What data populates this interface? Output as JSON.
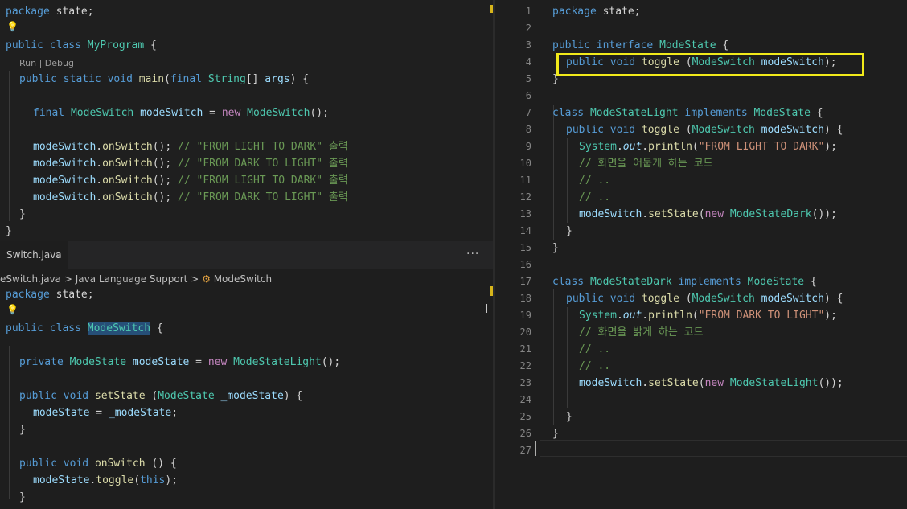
{
  "top_left": {
    "codelens": "Run | Debug",
    "lines": [
      [
        [
          "package",
          "kw"
        ],
        [
          " state;",
          "pl"
        ]
      ],
      [
        [
          "public",
          "kw"
        ],
        [
          " ",
          "pl"
        ],
        [
          "class",
          "kw"
        ],
        [
          " ",
          "pl"
        ],
        [
          "MyProgram",
          "type"
        ],
        [
          " {",
          "pl"
        ]
      ],
      [
        [
          "public",
          "kw"
        ],
        [
          " ",
          "pl"
        ],
        [
          "static",
          "kw"
        ],
        [
          " ",
          "pl"
        ],
        [
          "void",
          "kw"
        ],
        [
          " ",
          "pl"
        ],
        [
          "main",
          "fn"
        ],
        [
          "(",
          "pl"
        ],
        [
          "final",
          "kw"
        ],
        [
          " ",
          "pl"
        ],
        [
          "String",
          "type"
        ],
        [
          "[] ",
          "pl"
        ],
        [
          "args",
          "var"
        ],
        [
          ") {",
          "pl"
        ]
      ],
      [
        [
          "final",
          "kw"
        ],
        [
          " ",
          "pl"
        ],
        [
          "ModeSwitch",
          "type"
        ],
        [
          " ",
          "pl"
        ],
        [
          "modeSwitch",
          "var"
        ],
        [
          " = ",
          "pl"
        ],
        [
          "new",
          "ctl"
        ],
        [
          " ",
          "pl"
        ],
        [
          "ModeSwitch",
          "type"
        ],
        [
          "();",
          "pl"
        ]
      ],
      [
        [
          "modeSwitch",
          "var"
        ],
        [
          ".",
          "pl"
        ],
        [
          "onSwitch",
          "fn"
        ],
        [
          "(); ",
          "pl"
        ],
        [
          "// \"FROM LIGHT TO DARK\" 출력",
          "com"
        ]
      ],
      [
        [
          "modeSwitch",
          "var"
        ],
        [
          ".",
          "pl"
        ],
        [
          "onSwitch",
          "fn"
        ],
        [
          "(); ",
          "pl"
        ],
        [
          "// \"FROM DARK TO LIGHT\" 출력",
          "com"
        ]
      ],
      [
        [
          "modeSwitch",
          "var"
        ],
        [
          ".",
          "pl"
        ],
        [
          "onSwitch",
          "fn"
        ],
        [
          "(); ",
          "pl"
        ],
        [
          "// \"FROM LIGHT TO DARK\" 출력",
          "com"
        ]
      ],
      [
        [
          "modeSwitch",
          "var"
        ],
        [
          ".",
          "pl"
        ],
        [
          "onSwitch",
          "fn"
        ],
        [
          "(); ",
          "pl"
        ],
        [
          "// \"FROM DARK TO LIGHT\" 출력",
          "com"
        ]
      ],
      [
        [
          "}",
          "pl"
        ]
      ],
      [
        [
          "}",
          "pl"
        ]
      ]
    ]
  },
  "bottom_left": {
    "tab_label": "Switch.java",
    "tab_close": "×",
    "more_actions": "···",
    "breadcrumb": {
      "file": "eSwitch.java",
      "sep1": ">",
      "section": "Java Language Support",
      "sep2": ">",
      "icon": "symbol-class-icon",
      "symbol": "ModeSwitch"
    },
    "lines": [
      [
        [
          "package",
          "kw"
        ],
        [
          " state;",
          "pl"
        ]
      ],
      [
        [
          "public",
          "kw"
        ],
        [
          " ",
          "pl"
        ],
        [
          "class",
          "kw"
        ],
        [
          " ",
          "pl"
        ],
        [
          "ModeSwitch",
          "type-sel"
        ],
        [
          " {",
          "pl"
        ]
      ],
      [
        [
          "private",
          "kw"
        ],
        [
          " ",
          "pl"
        ],
        [
          "ModeState",
          "type"
        ],
        [
          " ",
          "pl"
        ],
        [
          "modeState",
          "var"
        ],
        [
          " = ",
          "pl"
        ],
        [
          "new",
          "ctl"
        ],
        [
          " ",
          "pl"
        ],
        [
          "ModeStateLight",
          "type"
        ],
        [
          "();",
          "pl"
        ]
      ],
      [
        [
          "public",
          "kw"
        ],
        [
          " ",
          "pl"
        ],
        [
          "void",
          "kw"
        ],
        [
          " ",
          "pl"
        ],
        [
          "setState",
          "fn"
        ],
        [
          " (",
          "pl"
        ],
        [
          "ModeState",
          "type"
        ],
        [
          " ",
          "pl"
        ],
        [
          "_modeState",
          "var"
        ],
        [
          ") {",
          "pl"
        ]
      ],
      [
        [
          "modeState",
          "var"
        ],
        [
          " = ",
          "pl"
        ],
        [
          "_modeState",
          "var"
        ],
        [
          ";",
          "pl"
        ]
      ],
      [
        [
          "}",
          "pl"
        ]
      ],
      [
        [
          "public",
          "kw"
        ],
        [
          " ",
          "pl"
        ],
        [
          "void",
          "kw"
        ],
        [
          " ",
          "pl"
        ],
        [
          "onSwitch",
          "fn"
        ],
        [
          " () {",
          "pl"
        ]
      ],
      [
        [
          "modeState",
          "var"
        ],
        [
          ".",
          "pl"
        ],
        [
          "toggle",
          "fn"
        ],
        [
          "(",
          "pl"
        ],
        [
          "this",
          "kw"
        ],
        [
          ");",
          "pl"
        ]
      ],
      [
        [
          "}",
          "pl"
        ]
      ]
    ]
  },
  "right": {
    "line_numbers": [
      "1",
      "2",
      "3",
      "4",
      "5",
      "6",
      "7",
      "8",
      "9",
      "10",
      "11",
      "12",
      "13",
      "14",
      "15",
      "16",
      "17",
      "18",
      "19",
      "20",
      "21",
      "22",
      "23",
      "24",
      "25",
      "26",
      "27"
    ],
    "lines": [
      [
        [
          "package",
          "kw"
        ],
        [
          " state;",
          "pl"
        ]
      ],
      [],
      [
        [
          "public",
          "kw"
        ],
        [
          " ",
          "pl"
        ],
        [
          "interface",
          "kw"
        ],
        [
          " ",
          "pl"
        ],
        [
          "ModeState",
          "type"
        ],
        [
          " {",
          "pl"
        ]
      ],
      [
        [
          "public",
          "kw"
        ],
        [
          " ",
          "pl"
        ],
        [
          "void",
          "kw"
        ],
        [
          " ",
          "pl"
        ],
        [
          "toggle",
          "fn"
        ],
        [
          " (",
          "pl"
        ],
        [
          "ModeSwitch",
          "type"
        ],
        [
          " ",
          "pl"
        ],
        [
          "modeSwitch",
          "var"
        ],
        [
          ");",
          "pl"
        ]
      ],
      [
        [
          "}",
          "pl"
        ]
      ],
      [],
      [
        [
          "class",
          "kw"
        ],
        [
          " ",
          "pl"
        ],
        [
          "ModeStateLight",
          "type"
        ],
        [
          " ",
          "pl"
        ],
        [
          "implements",
          "kw"
        ],
        [
          " ",
          "pl"
        ],
        [
          "ModeState",
          "type"
        ],
        [
          " {",
          "pl"
        ]
      ],
      [
        [
          "public",
          "kw"
        ],
        [
          " ",
          "pl"
        ],
        [
          "void",
          "kw"
        ],
        [
          " ",
          "pl"
        ],
        [
          "toggle",
          "fn"
        ],
        [
          " (",
          "pl"
        ],
        [
          "ModeSwitch",
          "type"
        ],
        [
          " ",
          "pl"
        ],
        [
          "modeSwitch",
          "var"
        ],
        [
          ") {",
          "pl"
        ]
      ],
      [
        [
          "System",
          "type"
        ],
        [
          ".",
          "pl"
        ],
        [
          "out",
          "it"
        ],
        [
          ".",
          "pl"
        ],
        [
          "println",
          "fn"
        ],
        [
          "(",
          "pl"
        ],
        [
          "\"FROM LIGHT TO DARK\"",
          "str"
        ],
        [
          ");",
          "pl"
        ]
      ],
      [
        [
          "// 화면을 어둡게 하는 코드",
          "com"
        ]
      ],
      [
        [
          "// ..",
          "com"
        ]
      ],
      [
        [
          "// ..",
          "com"
        ]
      ],
      [
        [
          "modeSwitch",
          "var"
        ],
        [
          ".",
          "pl"
        ],
        [
          "setState",
          "fn"
        ],
        [
          "(",
          "pl"
        ],
        [
          "new",
          "ctl"
        ],
        [
          " ",
          "pl"
        ],
        [
          "ModeStateDark",
          "type"
        ],
        [
          "());",
          "pl"
        ]
      ],
      [
        [
          "}",
          "pl"
        ]
      ],
      [
        [
          "}",
          "pl"
        ]
      ],
      [],
      [
        [
          "class",
          "kw"
        ],
        [
          " ",
          "pl"
        ],
        [
          "ModeStateDark",
          "type"
        ],
        [
          " ",
          "pl"
        ],
        [
          "implements",
          "kw"
        ],
        [
          " ",
          "pl"
        ],
        [
          "ModeState",
          "type"
        ],
        [
          " {",
          "pl"
        ]
      ],
      [
        [
          "public",
          "kw"
        ],
        [
          " ",
          "pl"
        ],
        [
          "void",
          "kw"
        ],
        [
          " ",
          "pl"
        ],
        [
          "toggle",
          "fn"
        ],
        [
          " (",
          "pl"
        ],
        [
          "ModeSwitch",
          "type"
        ],
        [
          " ",
          "pl"
        ],
        [
          "modeSwitch",
          "var"
        ],
        [
          ") {",
          "pl"
        ]
      ],
      [
        [
          "System",
          "type"
        ],
        [
          ".",
          "pl"
        ],
        [
          "out",
          "it"
        ],
        [
          ".",
          "pl"
        ],
        [
          "println",
          "fn"
        ],
        [
          "(",
          "pl"
        ],
        [
          "\"FROM DARK TO LIGHT\"",
          "str"
        ],
        [
          ");",
          "pl"
        ]
      ],
      [
        [
          "// 화면을 밝게 하는 코드",
          "com"
        ]
      ],
      [
        [
          "// ..",
          "com"
        ]
      ],
      [
        [
          "// ..",
          "com"
        ]
      ],
      [
        [
          "modeSwitch",
          "var"
        ],
        [
          ".",
          "pl"
        ],
        [
          "setState",
          "fn"
        ],
        [
          "(",
          "pl"
        ],
        [
          "new",
          "ctl"
        ],
        [
          " ",
          "pl"
        ],
        [
          "ModeStateLight",
          "type"
        ],
        [
          "());",
          "pl"
        ]
      ],
      [],
      [
        [
          "}",
          "pl"
        ]
      ],
      [
        [
          "}",
          "pl"
        ]
      ],
      []
    ]
  },
  "colors": {
    "highlight_box": "#f1e91a",
    "keyword": "#569cd6",
    "type": "#4ec9b0",
    "function": "#dcdcaa",
    "string": "#ce9178",
    "comment": "#6a9955"
  },
  "icons": {
    "lightbulb": "lightbulb-icon",
    "close": "close-icon",
    "more": "more-actions-icon",
    "text_cursor": "text-cursor-icon"
  },
  "misc": {
    "bulb_glyph": "💡",
    "cursor_glyph": "I"
  }
}
